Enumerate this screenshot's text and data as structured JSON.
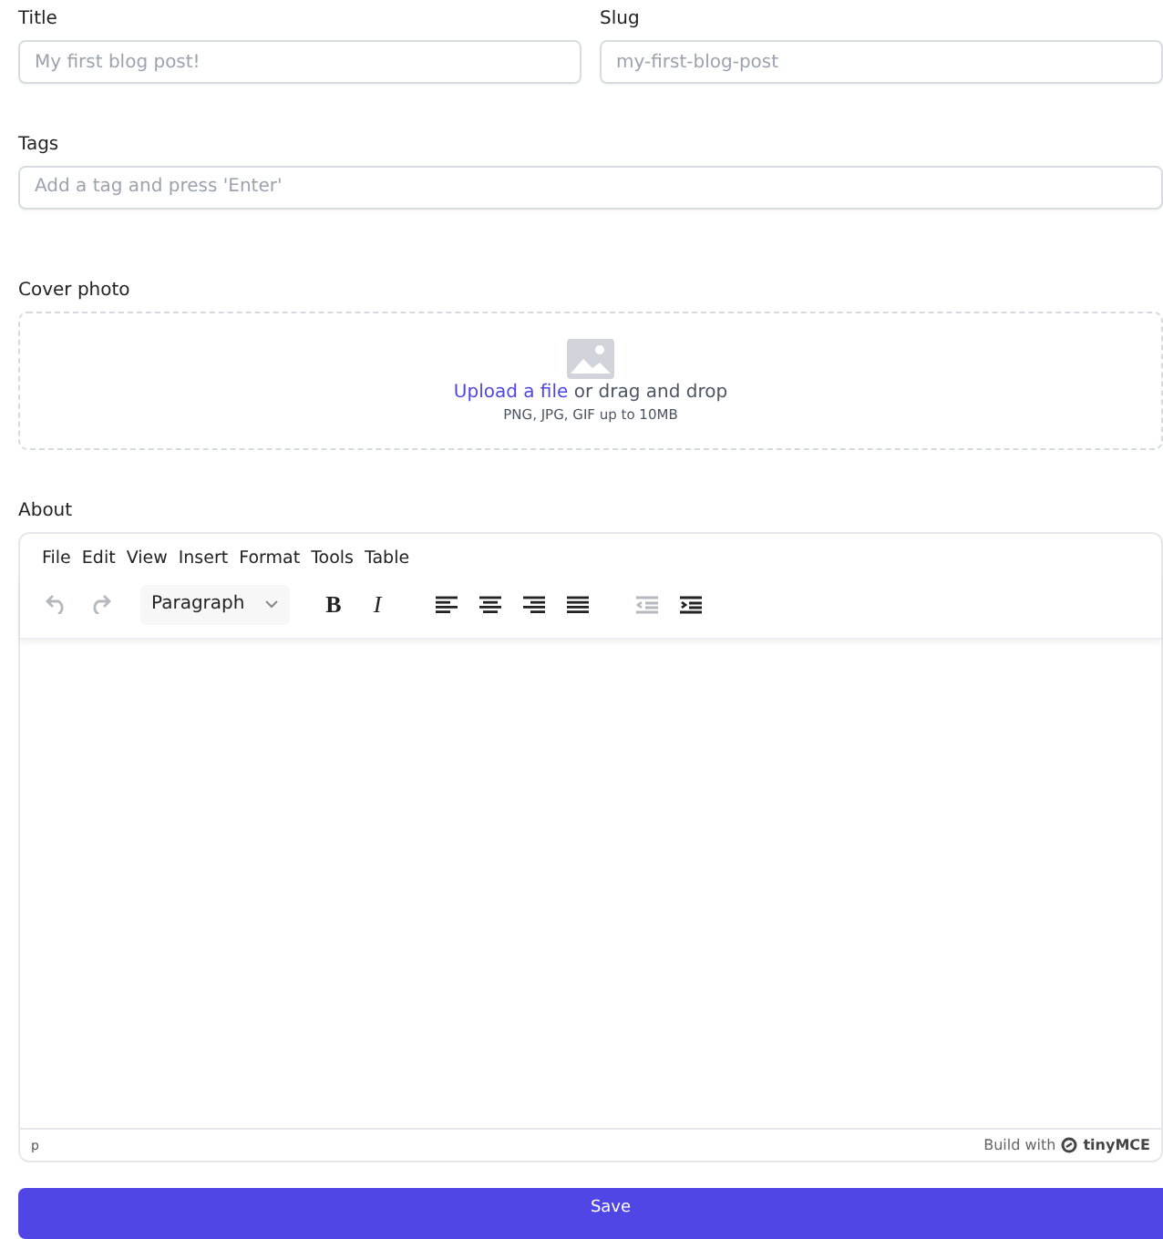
{
  "fields": [
    {
      "label": "Title",
      "placeholder": "My first blog post!"
    },
    {
      "label": "Slug",
      "placeholder": "my-first-blog-post"
    }
  ],
  "tags": {
    "label": "Tags",
    "placeholder": "Add a tag and press 'Enter'"
  },
  "cover_photo": {
    "label": "Cover photo",
    "link": "Upload a file",
    "text": " or drag and drop",
    "hint": "PNG, JPG, GIF up to 10MB"
  },
  "about": {
    "label": "About",
    "menu": [
      "File",
      "Edit",
      "View",
      "Insert",
      "Format",
      "Tools",
      "Table"
    ],
    "toolbar": [
      {
        "kind": "undo",
        "disabled": true
      },
      {
        "kind": "redo",
        "disabled": true
      },
      {
        "kind": "select",
        "text": "Paragraph"
      },
      {
        "kind": "bold",
        "text": "B"
      },
      {
        "kind": "italic",
        "text": "I"
      },
      {
        "kind": "align-left"
      },
      {
        "kind": "align-center"
      },
      {
        "kind": "align-right"
      },
      {
        "kind": "justify"
      },
      {
        "kind": "outdent",
        "disabled": true
      },
      {
        "kind": "indent",
        "disabled": false
      }
    ],
    "status_path": "p",
    "credit": "Build with",
    "brand": "tinyMCE"
  },
  "save_button": "Save"
}
